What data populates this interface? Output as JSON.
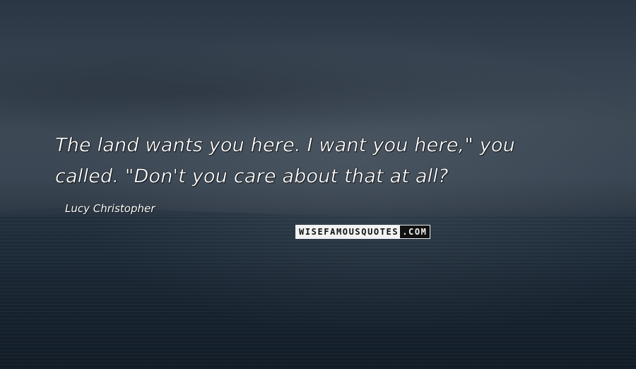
{
  "quote": {
    "line1": "The land wants you here. I want you here,\" you",
    "line2": "called. \"Don't you care about that at all?"
  },
  "author": "Lucy Christopher",
  "watermark": {
    "left": "WISEFAMOUSQUOTES",
    "right": ".COM"
  },
  "colors": {
    "text": "#ffffff",
    "sky": "#3d4955",
    "sea": "#1a2734"
  }
}
